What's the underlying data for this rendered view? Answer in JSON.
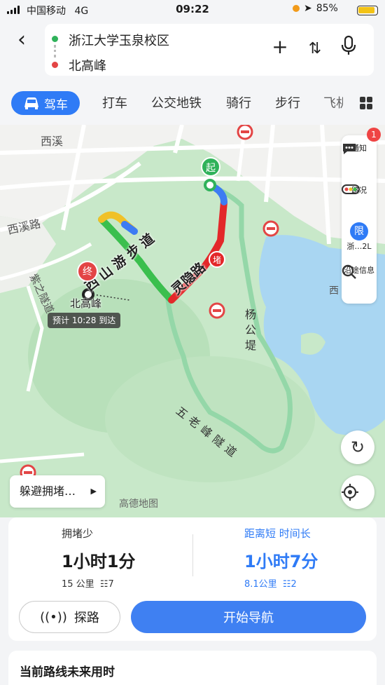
{
  "status_bar": {
    "carrier": "中国移动",
    "network": "4G",
    "time": "09:22",
    "battery": "85%"
  },
  "search": {
    "origin": "浙江大学玉泉校区",
    "destination": "北高峰"
  },
  "modes": [
    {
      "label": "驾车",
      "active": true
    },
    {
      "label": "打车"
    },
    {
      "label": "公交地铁"
    },
    {
      "label": "骑行"
    },
    {
      "label": "步行"
    },
    {
      "label": "飞机"
    }
  ],
  "map": {
    "labels": {
      "xixi": "西溪",
      "xixi_road": "西溪路",
      "ziyi_tunnel": "紫之隧道",
      "lingyin_road": "灵隐路",
      "shanyou_path": "西山游步道",
      "yanggong_di": "杨公堤",
      "wulaofeng_tunnel": "五老峰隧道",
      "xi": "西",
      "watermark": "高德地图",
      "start_marker": "起",
      "end_marker": "终",
      "congestion_marker": "堵",
      "dest_label": "北高峰",
      "eta": "预计 10:28 到达"
    },
    "tools": {
      "notice": "通知",
      "notice_count": "1",
      "traffic": "路况",
      "limit_icon": "限",
      "limit": "浙…2L",
      "along": "沿途信息"
    },
    "avoid_label": "躲避拥堵…",
    "colors": {
      "route_green": "#3bbf4e",
      "route_red": "#e3282a",
      "route_blue": "#3d7cf3",
      "route_yellow": "#f0c128",
      "alt_route": "#94d7a8",
      "water": "#a9d6f2"
    }
  },
  "routes": [
    {
      "tag": "拥堵少",
      "duration": "1小时1分",
      "distance": "15 公里",
      "lights": "7",
      "selected": true
    },
    {
      "tag": "距离短 时间长",
      "duration": "1小时7分",
      "distance": "8.1公里",
      "lights": "2",
      "selected": false
    }
  ],
  "actions": {
    "probe": "探路",
    "start_nav": "开始导航"
  },
  "future_time_label": "当前路线未来用时"
}
